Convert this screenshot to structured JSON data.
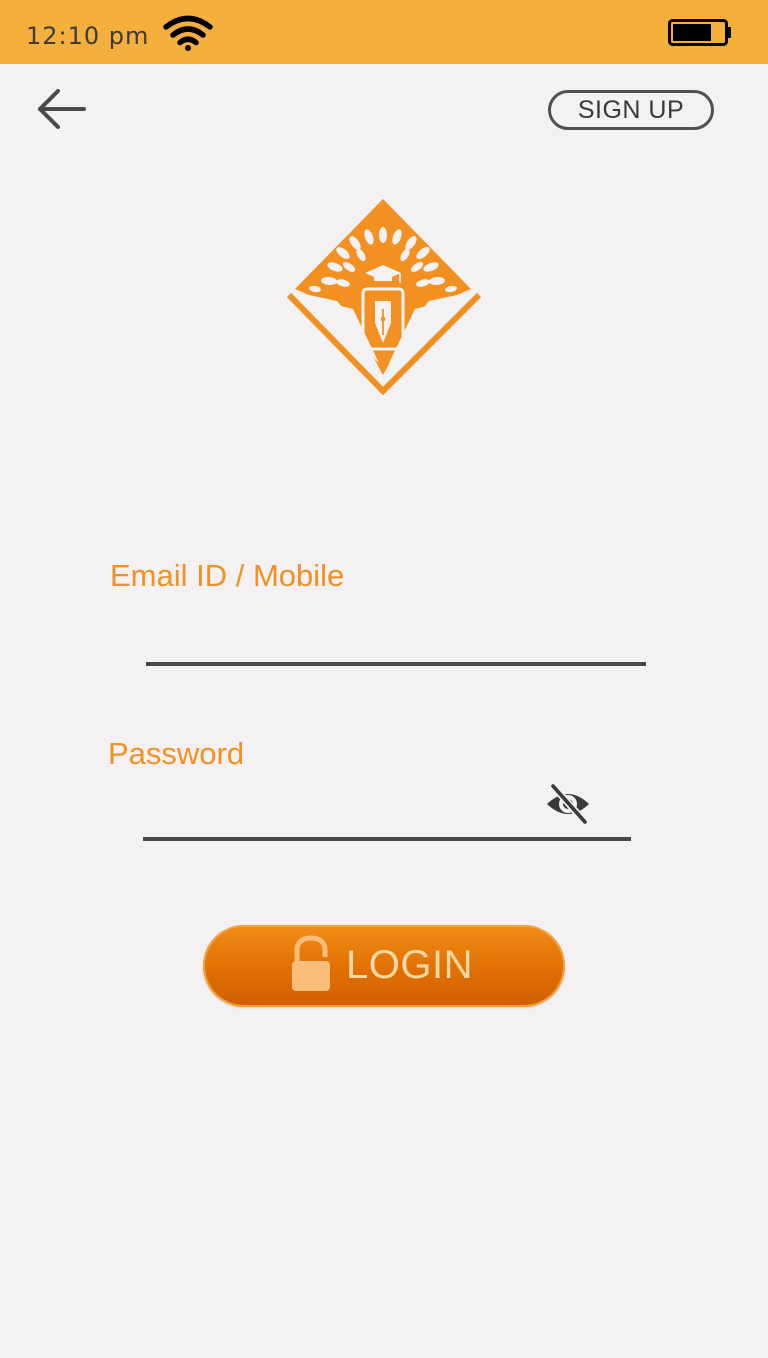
{
  "status_bar": {
    "time": "12:10 pm",
    "wifi_icon": "wifi-icon",
    "battery_icon": "battery-icon",
    "background_color": "#f4af3d"
  },
  "header": {
    "back_icon": "arrow-left-icon",
    "signup_label": "SIGN UP"
  },
  "logo": {
    "icon": "tree-pen-diamond-logo",
    "color": "#f29022"
  },
  "form": {
    "email_label": "Email ID / Mobile",
    "email_value": "",
    "password_label": "Password",
    "password_value": "",
    "password_toggle_icon": "eye-off-icon",
    "label_color": "#f29022"
  },
  "login_button": {
    "label": "LOGIN",
    "icon": "lock-icon",
    "color": "#e27204"
  }
}
